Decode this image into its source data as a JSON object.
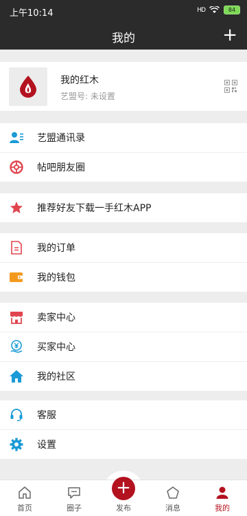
{
  "status": {
    "time": "上午10:14",
    "signal": "HD",
    "battery": "84"
  },
  "header": {
    "title": "我的"
  },
  "profile": {
    "name": "我的红木",
    "sub": "艺盟号: 未设置"
  },
  "groups": [
    {
      "items": [
        {
          "label": "艺盟通讯录",
          "icon": "contacts-icon"
        },
        {
          "label": "帖吧朋友圈",
          "icon": "moments-icon"
        }
      ]
    },
    {
      "items": [
        {
          "label": "推荐好友下载一手红木APP",
          "icon": "star-icon"
        }
      ]
    },
    {
      "items": [
        {
          "label": "我的订单",
          "icon": "order-icon"
        },
        {
          "label": "我的钱包",
          "icon": "wallet-icon"
        }
      ]
    },
    {
      "items": [
        {
          "label": "卖家中心",
          "icon": "store-icon"
        },
        {
          "label": "买家中心",
          "icon": "buyer-icon"
        },
        {
          "label": "我的社区",
          "icon": "home-icon"
        }
      ]
    },
    {
      "items": [
        {
          "label": "客服",
          "icon": "headset-icon"
        },
        {
          "label": "设置",
          "icon": "gear-icon"
        }
      ]
    }
  ],
  "tabbar": {
    "items": [
      {
        "label": "首页",
        "icon": "home-outline-icon"
      },
      {
        "label": "圈子",
        "icon": "chat-icon"
      },
      {
        "label": "发布",
        "icon": "publish-plus-icon"
      },
      {
        "label": "消息",
        "icon": "message-icon"
      },
      {
        "label": "我的",
        "icon": "person-icon"
      }
    ],
    "active_index": 4
  },
  "colors": {
    "accent": "#b3121f",
    "header_bg": "#2b2b2b",
    "icon_blue": "#1a9ad6",
    "icon_red": "#e0454f",
    "icon_orange": "#f39a1e"
  }
}
